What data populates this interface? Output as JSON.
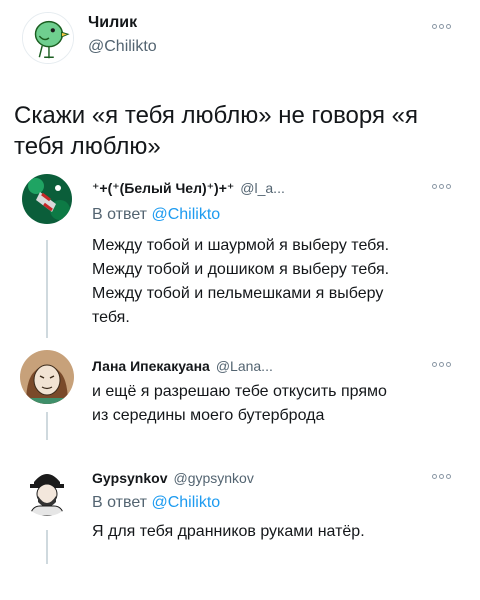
{
  "main_tweet": {
    "display_name": "Чилик",
    "handle": "@Chilikto",
    "text": "Скажи «я тебя люблю» не говоря «я тебя люблю»"
  },
  "replies": [
    {
      "display_name": "⁺+(⁺(Белый Чел)⁺)+⁺",
      "handle": "@l_a...",
      "reply_to_prefix": "В ответ",
      "reply_to_handle": "@Chilikto",
      "lines": [
        "Между тобой и шаурмой я выберу тебя.",
        "Между тобой и дошиком я выберу тебя.",
        "Между тобой и пельмешками я выберу",
        "тебя."
      ]
    },
    {
      "display_name": "Лана Ипекакуана",
      "handle": "@Lana...",
      "lines": [
        "и ещё я разрешаю тебе откусить прямо",
        "из середины моего бутерброда"
      ]
    },
    {
      "display_name": "Gypsynkov",
      "handle": "@gypsynkov",
      "reply_to_prefix": "В ответ",
      "reply_to_handle": "@Chilikto",
      "lines": [
        "Я для тебя дранников руками натёр."
      ]
    }
  ],
  "icons": {
    "more": "more-dots-icon"
  }
}
